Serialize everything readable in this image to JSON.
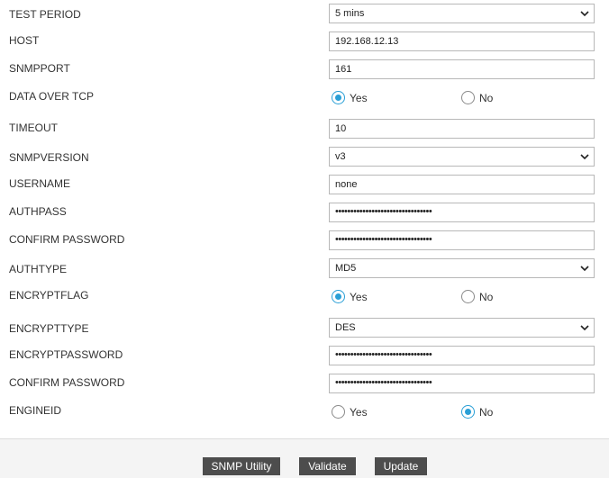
{
  "form": {
    "test_period": {
      "label": "TEST PERIOD",
      "value": "5 mins"
    },
    "host": {
      "label": "HOST",
      "value": "192.168.12.13"
    },
    "snmpport": {
      "label": "SNMPPORT",
      "value": "161"
    },
    "data_over_tcp": {
      "label": "DATA OVER TCP",
      "yes": "Yes",
      "no": "No",
      "selected": "Yes"
    },
    "timeout": {
      "label": "TIMEOUT",
      "value": "10"
    },
    "snmpversion": {
      "label": "SNMPVERSION",
      "value": "v3"
    },
    "username": {
      "label": "USERNAME",
      "value": "none"
    },
    "authpass": {
      "label": "AUTHPASS",
      "value": "••••••••••••••••••••••••••••••••"
    },
    "confirm_password_1": {
      "label": "CONFIRM PASSWORD",
      "value": "••••••••••••••••••••••••••••••••"
    },
    "authtype": {
      "label": "AUTHTYPE",
      "value": "MD5"
    },
    "encryptflag": {
      "label": "ENCRYPTFLAG",
      "yes": "Yes",
      "no": "No",
      "selected": "Yes"
    },
    "encrypttype": {
      "label": "ENCRYPTTYPE",
      "value": "DES"
    },
    "encryptpassword": {
      "label": "ENCRYPTPASSWORD",
      "value": "••••••••••••••••••••••••••••••••"
    },
    "confirm_password_2": {
      "label": "CONFIRM PASSWORD",
      "value": "••••••••••••••••••••••••••••••••"
    },
    "engineid": {
      "label": "ENGINEID",
      "yes": "Yes",
      "no": "No",
      "selected": "No"
    }
  },
  "footer": {
    "snmp_utility": "SNMP Utility",
    "validate": "Validate",
    "update": "Update"
  },
  "colors": {
    "accent": "#2a9fd6",
    "button_bg": "#4d4d4d",
    "footer_bg": "#f4f4f4"
  }
}
